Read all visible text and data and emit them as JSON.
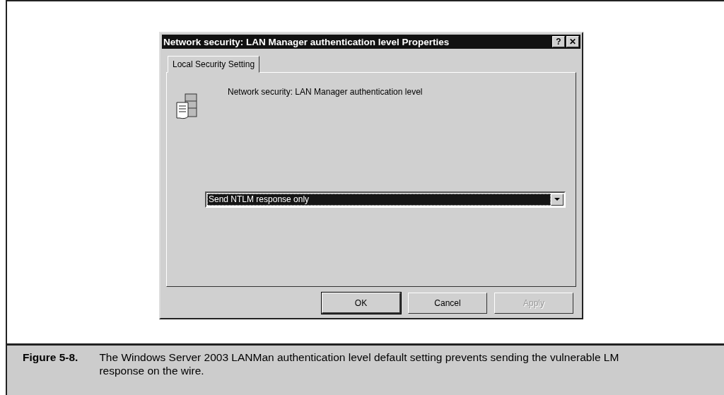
{
  "dialog": {
    "title": "Network security: LAN Manager authentication level Properties",
    "title_buttons": [
      "?",
      "✕"
    ]
  },
  "tabs": [
    {
      "label": "Local Security Setting",
      "selected": true
    }
  ],
  "setting": {
    "label": "Network security: LAN Manager authentication level"
  },
  "dropdown": {
    "value": "Send NTLM response only",
    "focused": true
  },
  "buttons": [
    {
      "label": "OK",
      "default": true,
      "disabled": false
    },
    {
      "label": "Cancel",
      "default": false,
      "disabled": false
    },
    {
      "label": "Apply",
      "default": false,
      "disabled": true
    }
  ],
  "caption": {
    "number": "Figure 5-8.",
    "text": "The Windows Server 2003 LANMan authentication level default setting prevents sending the vulnerable LM response on the wire."
  }
}
